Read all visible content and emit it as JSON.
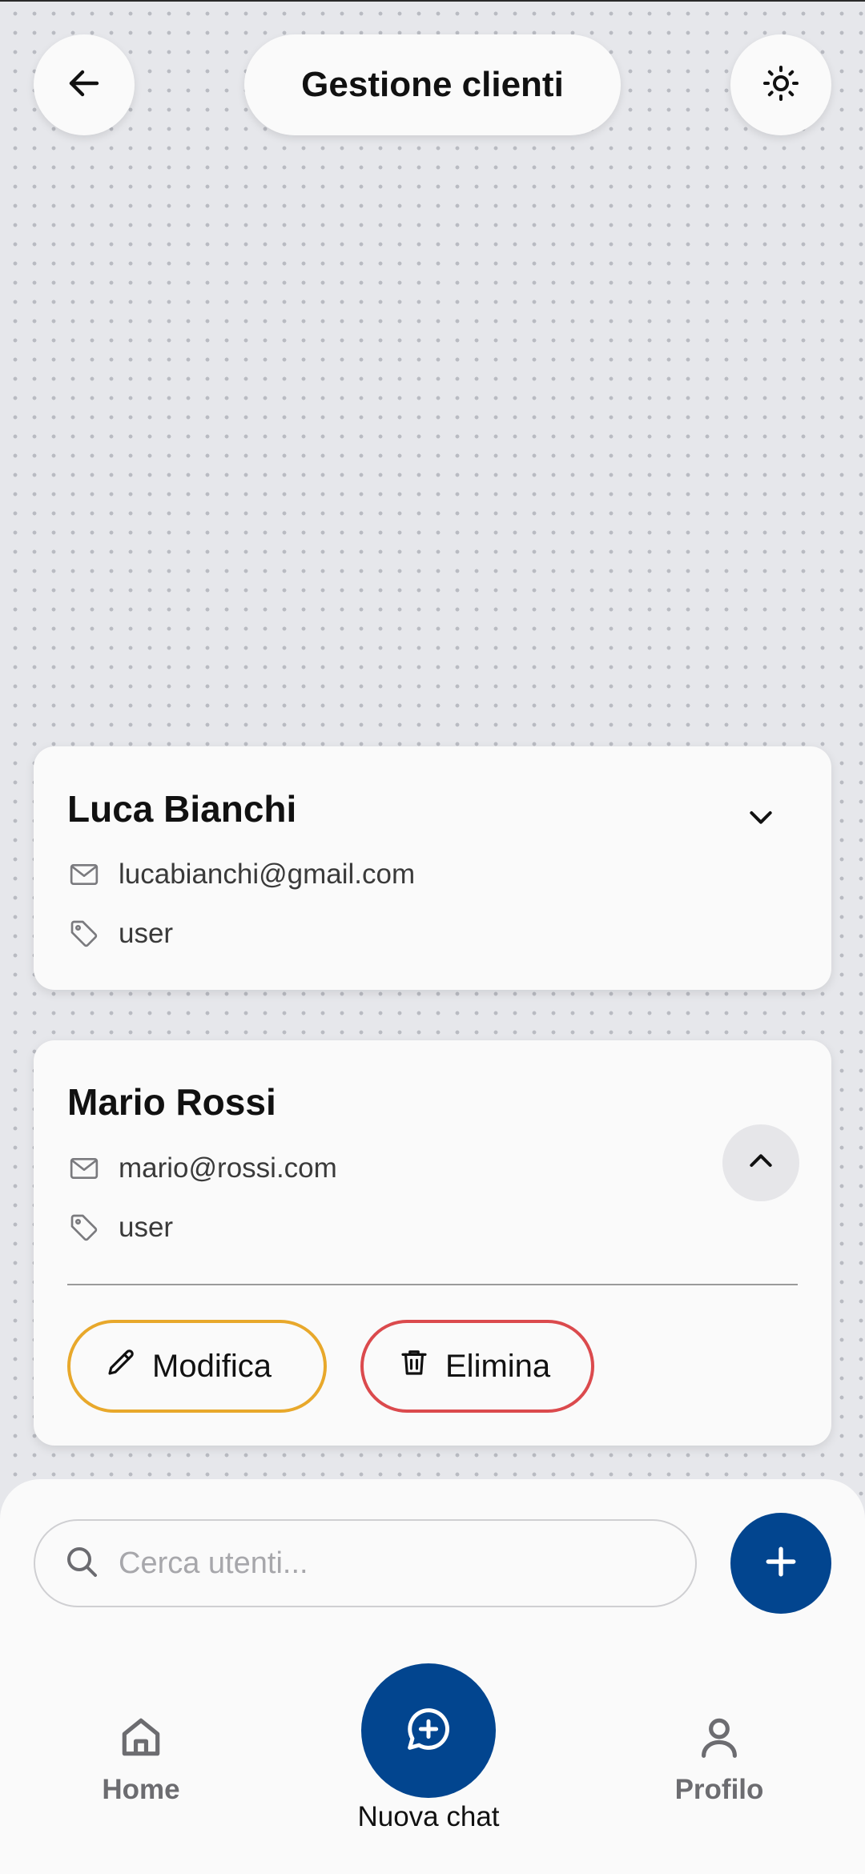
{
  "header": {
    "title": "Gestione clienti",
    "back_icon": "arrow-left-icon",
    "theme_icon": "sun-icon"
  },
  "clients": [
    {
      "name": "Luca Bianchi",
      "email": "lucabianchi@gmail.com",
      "role": "user",
      "expanded": false,
      "toggle_icon": "chevron-down-icon"
    },
    {
      "name": "Mario Rossi",
      "email": "mario@rossi.com",
      "role": "user",
      "expanded": true,
      "toggle_icon": "chevron-up-icon",
      "actions": {
        "edit_label": "Modifica",
        "delete_label": "Elimina"
      }
    }
  ],
  "search": {
    "value": "",
    "placeholder": "Cerca utenti..."
  },
  "bottom_nav": {
    "home_label": "Home",
    "new_chat_label": "Nuova chat",
    "profile_label": "Profilo"
  },
  "colors": {
    "primary": "#02458f",
    "edit_border": "#e8a82b",
    "delete_border": "#db4a4d",
    "background": "#e6e7eb",
    "card": "#fafafa"
  }
}
